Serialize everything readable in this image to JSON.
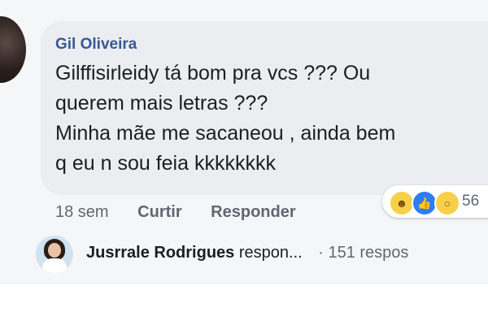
{
  "comment": {
    "author": "Gil Oliveira",
    "lines": [
      "Gilffisirleidy tá bom pra vcs ??? Ou",
      "querem mais letras ???",
      "Minha mãe me sacaneou , ainda bem",
      "q eu n sou feia kkkkkkkk"
    ]
  },
  "meta": {
    "time": "18 sem",
    "like_label": "Curtir",
    "reply_label": "Responder"
  },
  "reactions": {
    "icons": [
      "haha-icon",
      "like-icon",
      "wow-icon"
    ],
    "count": "56"
  },
  "reply_preview": {
    "name": "Jusrrale Rodrigues",
    "action": "respon...",
    "count": "· 151 respos"
  },
  "colors": {
    "author": "#385898",
    "bubble": "#ebedf0",
    "like": "#2d7df6",
    "reaction_yellow": "#f7d04a"
  }
}
